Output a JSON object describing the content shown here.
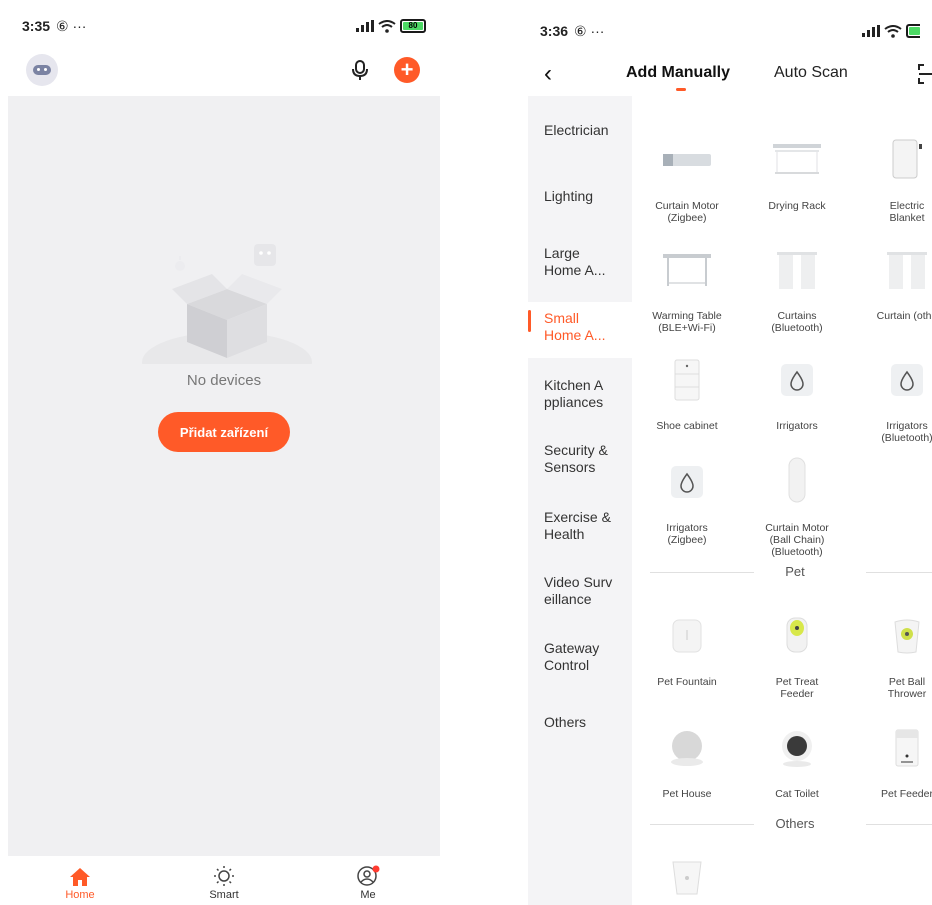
{
  "left": {
    "status": {
      "time": "3:35",
      "extra": "⑥ ···",
      "battery": "80"
    },
    "empty_text": "No devices",
    "add_button": "Přidat zařízení",
    "tabs": [
      {
        "label": "Home"
      },
      {
        "label": "Smart"
      },
      {
        "label": "Me"
      }
    ],
    "accent": "#ff5a28"
  },
  "right": {
    "status": {
      "time": "3:36",
      "extra": "⑥ ···"
    },
    "nav": {
      "back": "‹",
      "manual": "Add Manually",
      "scan": "Auto Scan"
    },
    "categories": [
      {
        "label": "Electrician"
      },
      {
        "label": "Lighting"
      },
      {
        "label": "Large\nHome A..."
      },
      {
        "label": "Small\nHome A..."
      },
      {
        "label": "Kitchen A\nppliances"
      },
      {
        "label": "Security &\nSensors"
      },
      {
        "label": "Exercise &\nHealth"
      },
      {
        "label": "Video Surv\neillance"
      },
      {
        "label": "Gateway\nControl"
      },
      {
        "label": "Others"
      }
    ],
    "devices": [
      {
        "label": "Curtain Motor\n(Zigbee)",
        "icon": "curtain-motor-icon"
      },
      {
        "label": "Drying Rack",
        "icon": "drying-rack-icon"
      },
      {
        "label": "Electric\nBlanket",
        "icon": "electric-blanket-icon"
      },
      {
        "label": "Warming Table\n(BLE+Wi-Fi)",
        "icon": "warming-table-icon"
      },
      {
        "label": "Curtains\n(Bluetooth)",
        "icon": "curtains-icon"
      },
      {
        "label": "Curtain (othe",
        "icon": "curtain-other-icon"
      },
      {
        "label": "Shoe cabinet",
        "icon": "shoe-cabinet-icon"
      },
      {
        "label": "Irrigators",
        "icon": "irrigator-icon"
      },
      {
        "label": "Irrigators\n(Bluetooth)",
        "icon": "irrigator-bt-icon"
      },
      {
        "label": "Irrigators\n(Zigbee)",
        "icon": "irrigator-zigbee-icon"
      },
      {
        "label": "Curtain Motor\n(Ball Chain)\n(Bluetooth)",
        "icon": "curtain-motor-ball-icon"
      }
    ],
    "pet_section": "Pet",
    "pet_devices": [
      {
        "label": "Pet Fountain",
        "icon": "pet-fountain-icon"
      },
      {
        "label": "Pet Treat\nFeeder",
        "icon": "pet-treat-feeder-icon"
      },
      {
        "label": "Pet Ball\nThrower",
        "icon": "pet-ball-thrower-icon"
      },
      {
        "label": "Pet House",
        "icon": "pet-house-icon"
      },
      {
        "label": "Cat Toilet",
        "icon": "cat-toilet-icon"
      },
      {
        "label": "Pet Feeder",
        "icon": "pet-feeder-icon"
      }
    ],
    "others_section": "Others"
  }
}
